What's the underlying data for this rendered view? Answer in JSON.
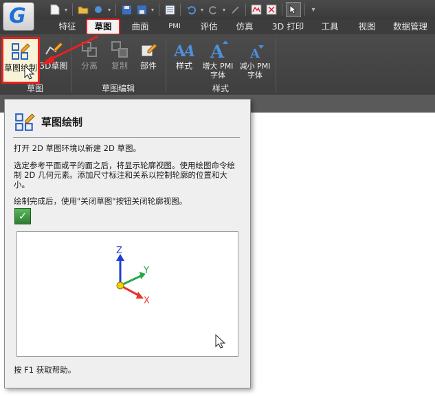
{
  "app": {
    "logo_letter": "G"
  },
  "qat": {
    "buttons": [
      {
        "icon": "new-file-icon",
        "glyph": "🗋"
      },
      {
        "icon": "open-folder-icon",
        "glyph": "📂"
      },
      {
        "icon": "save-icon",
        "glyph": "💾"
      },
      {
        "icon": "save-as-icon",
        "glyph": "🖫"
      },
      {
        "icon": "properties-icon",
        "glyph": "☰"
      },
      {
        "icon": "undo-icon",
        "glyph": "↶"
      },
      {
        "icon": "redo-icon",
        "glyph": "↷"
      },
      {
        "icon": "select-icon",
        "glyph": "⬚"
      },
      {
        "icon": "pointer-icon",
        "glyph": "↖"
      },
      {
        "icon": "customize-icon",
        "glyph": "▾"
      }
    ]
  },
  "tabs": [
    {
      "label": "特征",
      "active": false
    },
    {
      "label": "草图",
      "active": true
    },
    {
      "label": "曲面",
      "active": false
    },
    {
      "label": "PMI",
      "active": false
    },
    {
      "label": "评估",
      "active": false
    },
    {
      "label": "仿真",
      "active": false
    },
    {
      "label": "3D 打印",
      "active": false
    },
    {
      "label": "工具",
      "active": false
    },
    {
      "label": "视图",
      "active": false
    },
    {
      "label": "数据管理",
      "active": false
    }
  ],
  "ribbon": {
    "sketch_group": {
      "name": "草图",
      "buttons": [
        {
          "label": "草图绘制",
          "icon": "sketch-draw-icon"
        },
        {
          "label": "3D草图",
          "icon": "3d-sketch-icon"
        }
      ]
    },
    "sketch_edit_group": {
      "name": "草图编辑",
      "buttons": [
        {
          "label": "分离",
          "icon": "separate-icon",
          "enabled": false
        },
        {
          "label": "复制",
          "icon": "copy-icon",
          "enabled": false
        },
        {
          "label": "部件",
          "icon": "part-icon",
          "enabled": true
        }
      ]
    },
    "style_group": {
      "name": "样式",
      "buttons": [
        {
          "label": "样式",
          "icon": "style-icon"
        },
        {
          "label_line1": "增大 PMI",
          "label_line2": "字体",
          "icon": "font-increase-icon"
        },
        {
          "label_line1": "减小 PMI",
          "label_line2": "字体",
          "icon": "font-decrease-icon"
        }
      ]
    }
  },
  "tooltip": {
    "title": "草图绘制",
    "desc1": "打开 2D 草图环境以新建 2D 草图。",
    "desc2": "选定参考平面或平的面之后，将显示轮廓视图。使用绘图命令绘制 2D 几何元素。添加尺寸标注和关系以控制轮廓的位置和大小。",
    "desc3": "绘制完成后，使用\"关闭草图\"按钮关闭轮廓视图。",
    "help": "按 F1 获取帮助。",
    "axes": {
      "x": "X",
      "y": "Y",
      "z": "Z"
    },
    "colors": {
      "x": "#e8342a",
      "y": "#28a745",
      "z": "#1c3fd1"
    }
  }
}
